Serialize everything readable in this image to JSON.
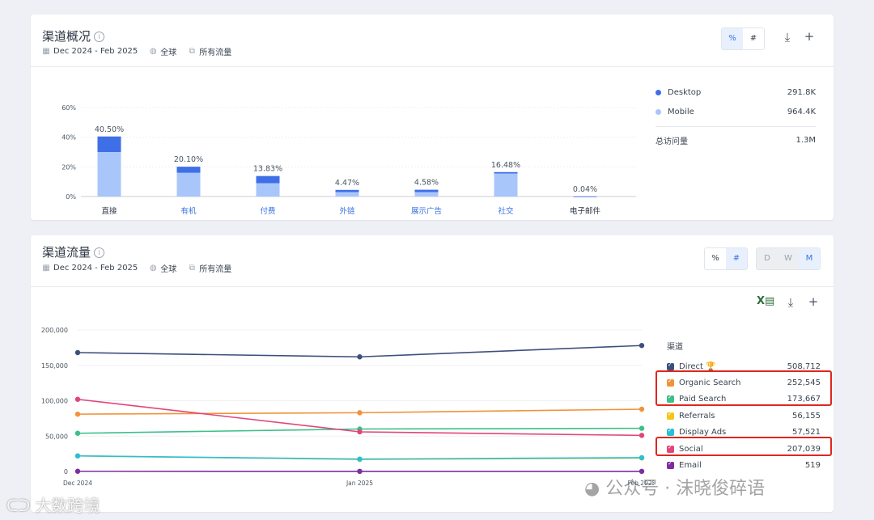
{
  "overview": {
    "title": "渠道概况",
    "date_range": "Dec 2024 - Feb 2025",
    "region": "全球",
    "traffic_type": "所有流量",
    "toggle": [
      "%",
      "#"
    ],
    "legend": [
      {
        "name": "Desktop",
        "value": "291.8K",
        "color": "#3e6fe6"
      },
      {
        "name": "Mobile",
        "value": "964.4K",
        "color": "#a9c6fb"
      }
    ],
    "total_label": "总访问量",
    "total_value": "1.3M"
  },
  "trend": {
    "title": "渠道流量",
    "date_range": "Dec 2024 - Feb 2025",
    "region": "全球",
    "traffic_type": "所有流量",
    "toggle": [
      "%",
      "#"
    ],
    "period_toggle": [
      "D",
      "W",
      "M"
    ],
    "legend_title": "渠道",
    "legend": [
      {
        "name": "Direct",
        "value": "508,712",
        "color": "#3d4f7c"
      },
      {
        "name": "Organic Search",
        "value": "252,545",
        "color": "#f2923a"
      },
      {
        "name": "Paid Search",
        "value": "173,667",
        "color": "#3cc08a"
      },
      {
        "name": "Referrals",
        "value": "56,155",
        "color": "#f5c518"
      },
      {
        "name": "Display Ads",
        "value": "57,521",
        "color": "#2bbfd8"
      },
      {
        "name": "Social",
        "value": "207,039",
        "color": "#e2457a"
      },
      {
        "name": "Email",
        "value": "519",
        "color": "#7b2fa0"
      }
    ]
  },
  "watermark": {
    "right": "公众号 · 沫晓俊碎语",
    "left": "大数跨境"
  },
  "chart_data": [
    {
      "type": "bar",
      "stacked": true,
      "categories": [
        "直接",
        "有机",
        "付费",
        "外链",
        "展示广告",
        "社交",
        "电子邮件"
      ],
      "category_colors": [
        "#2b3440",
        "#3a73e0",
        "#3a73e0",
        "#3a73e0",
        "#3a73e0",
        "#3a73e0",
        "#2b3440"
      ],
      "data_labels": [
        "40.50%",
        "20.10%",
        "13.83%",
        "4.47%",
        "4.58%",
        "16.48%",
        "0.04%"
      ],
      "series": [
        {
          "name": "Mobile",
          "values": [
            30.0,
            16.0,
            9.0,
            3.0,
            3.0,
            15.5,
            0.03
          ]
        },
        {
          "name": "Desktop",
          "values": [
            10.5,
            4.1,
            4.83,
            1.47,
            1.58,
            0.98,
            0.01
          ]
        }
      ],
      "ylim": [
        0,
        60
      ],
      "yticks": [
        "0%",
        "20%",
        "40%",
        "60%"
      ],
      "ytick_values": [
        0,
        20,
        40,
        60
      ],
      "grid": true
    },
    {
      "type": "line",
      "x": [
        "Dec 2024",
        "Jan 2025",
        "Feb 2025"
      ],
      "series": [
        {
          "name": "Direct",
          "values": [
            168000,
            162000,
            178000
          ]
        },
        {
          "name": "Organic Search",
          "values": [
            81000,
            83000,
            88000
          ]
        },
        {
          "name": "Paid Search",
          "values": [
            54000,
            60000,
            61000
          ]
        },
        {
          "name": "Referrals",
          "values": [
            22000,
            17000,
            19000
          ]
        },
        {
          "name": "Display Ads",
          "values": [
            22000,
            17500,
            19500
          ]
        },
        {
          "name": "Social",
          "values": [
            102000,
            56000,
            51000
          ]
        },
        {
          "name": "Email",
          "values": [
            300,
            200,
            200
          ]
        }
      ],
      "ylim": [
        0,
        200000
      ],
      "yticks": [
        "0",
        "50,000",
        "100,000",
        "150,000",
        "200,000"
      ],
      "ytick_values": [
        0,
        50000,
        100000,
        150000,
        200000
      ],
      "grid": true
    }
  ]
}
